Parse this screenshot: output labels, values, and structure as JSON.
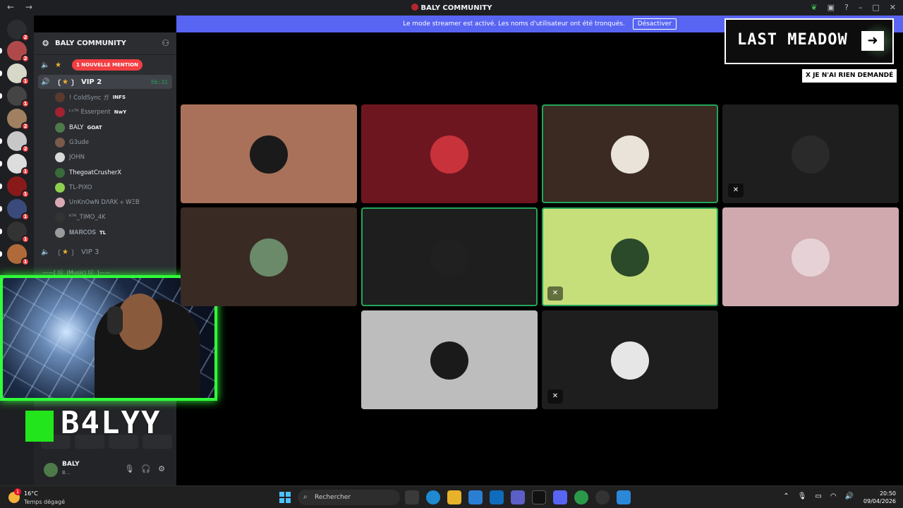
{
  "window": {
    "title": "BALY COMMUNITY",
    "nav_arrows": "← →"
  },
  "banner": {
    "text": "Le mode streamer est activé. Les noms d'utilisateur ont été tronqués.",
    "button": "Désactiver"
  },
  "server": {
    "name": "BALY COMMUNITY"
  },
  "channels": {
    "mention_pill": "1 NOUVELLE MENTION",
    "vip2": {
      "label": "VIP 2",
      "timer": "56:31"
    },
    "vip3": {
      "label": "VIP 3"
    },
    "music_category": "——[ 🎼 |Music| 🎼 ]——"
  },
  "voice_users": [
    {
      "name": "! ColdSync ガ",
      "tag": "INFS",
      "avatar_color": "#5b3a2e"
    },
    {
      "name": "ᴸˣᵀᴿ Esserpent",
      "tag": "NwY",
      "avatar_color": "#a32130"
    },
    {
      "name": "BALY",
      "tag": "GOAT",
      "avatar_color": "#4e7a4a",
      "bright": true
    },
    {
      "name": "G3ude",
      "tag": "",
      "avatar_color": "#7a5a4a"
    },
    {
      "name": "JOHN",
      "tag": "",
      "avatar_color": "#d9d9d9"
    },
    {
      "name": "ThegoatCrusherX",
      "tag": "",
      "avatar_color": "#3a6a3a",
      "bright": true
    },
    {
      "name": "TL-PIXO",
      "tag": "",
      "avatar_color": "#8fcf4f"
    },
    {
      "name": "UnKnOwN DΛRK ⟡ WΞB",
      "tag": "",
      "avatar_color": "#d8a9b4"
    },
    {
      "name": "ᴷᵀᴿ_TIMO_4K",
      "tag": "",
      "avatar_color": "#333333"
    },
    {
      "name": "𝐌𝐀𝐑𝐂𝐎𝐒",
      "tag": "TL",
      "avatar_color": "#9a9a9a"
    }
  ],
  "user_panel": {
    "name": "BALY",
    "status": "B..."
  },
  "overlay": {
    "brand": "B4LYY",
    "game_title": "LAST MEADOW",
    "x_tag": "X JE N'AI RIEN DEMANDÉ"
  },
  "tiles": [
    {
      "bg": "#a9715a",
      "avatar": "#1a1a1a",
      "speaking": false,
      "muted": false
    },
    {
      "bg": "#6e1620",
      "avatar": "#c8323a",
      "speaking": false,
      "muted": false
    },
    {
      "bg": "#3a2a22",
      "avatar": "#e9e3d9",
      "speaking": true,
      "muted": false
    },
    {
      "bg": "#1e1e1e",
      "avatar": "#2a2a2a",
      "speaking": false,
      "muted": true
    },
    {
      "bg": "#3a2a24",
      "avatar": "#6a8a6a",
      "speaking": false,
      "muted": false
    },
    {
      "bg": "#1e1e1e",
      "avatar": "#202020",
      "speaking": true,
      "muted": false
    },
    {
      "bg": "#c7df7a",
      "avatar": "#2a4a2a",
      "speaking": true,
      "muted": true
    },
    {
      "bg": "#cfa9ae",
      "avatar": "#e6d2d6",
      "speaking": false,
      "muted": false
    },
    {
      "bg": "#bdbdbd",
      "avatar": "#1a1a1a",
      "speaking": false,
      "muted": false
    },
    {
      "bg": "#1e1e1e",
      "avatar": "#e6e6e6",
      "speaking": false,
      "muted": true
    }
  ],
  "taskbar": {
    "temperature": "16°C",
    "weather": "Temps dégagé",
    "weather_badge": "1",
    "search_placeholder": "Rechercher",
    "time": "20:50",
    "date": "09/04/2026"
  }
}
